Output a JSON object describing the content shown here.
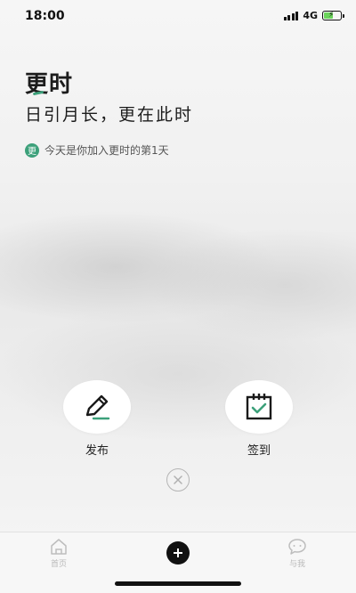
{
  "status_bar": {
    "time": "18:00",
    "network": "4G",
    "battery_level": 0.55,
    "colors": {
      "battery": "#6bd45b"
    }
  },
  "header": {
    "app_title": "更时",
    "slogan": "日引月长，更在此时",
    "join_badge": "更",
    "join_text": "今天是你加入更时的第1天",
    "accent_color": "#3ca07a"
  },
  "actions": {
    "publish_label": "发布",
    "checkin_label": "签到",
    "publish_icon": "pen-icon",
    "checkin_icon": "calendar-check-icon",
    "close_icon": "close-icon"
  },
  "tab_bar": {
    "home_label": "首页",
    "me_label": "与我",
    "home_icon": "home-icon",
    "add_icon": "plus-icon",
    "me_icon": "chat-icon"
  }
}
